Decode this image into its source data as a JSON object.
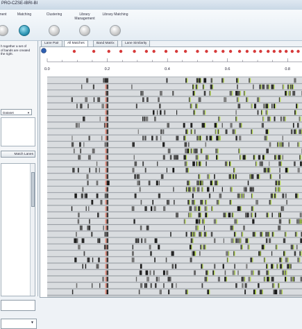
{
  "window": {
    "title": "PRO-CZSE-IBRI-BI"
  },
  "ribbon": {
    "steps": [
      {
        "label": "ment",
        "active": false
      },
      {
        "label": "Matching",
        "active": true
      },
      {
        "label": "Clustering",
        "active": false
      },
      {
        "label": "Library Management",
        "active": false
      },
      {
        "label": "Library Matching",
        "active": false
      }
    ]
  },
  "left_panel": {
    "description_lines": [
      "h together a set of",
      "of bands are created",
      "the right."
    ],
    "select_value": "Dataset",
    "match_button": "Match Lanes"
  },
  "tabs": [
    "Lane Pair",
    "All Matches",
    "Band Matrix",
    "Lane Similarity"
  ],
  "active_tab": "All Matches",
  "ruler": {
    "ticks": [
      "0.0",
      "0.2",
      "0.4",
      "0.6",
      "0.8"
    ]
  },
  "gel": {
    "lane_count": 34
  },
  "colors": {
    "accent": "#2e96b4",
    "match_marker": "#d63a3a",
    "band_highlight": "#b4d94a",
    "reference_band": "#e08a7a"
  }
}
